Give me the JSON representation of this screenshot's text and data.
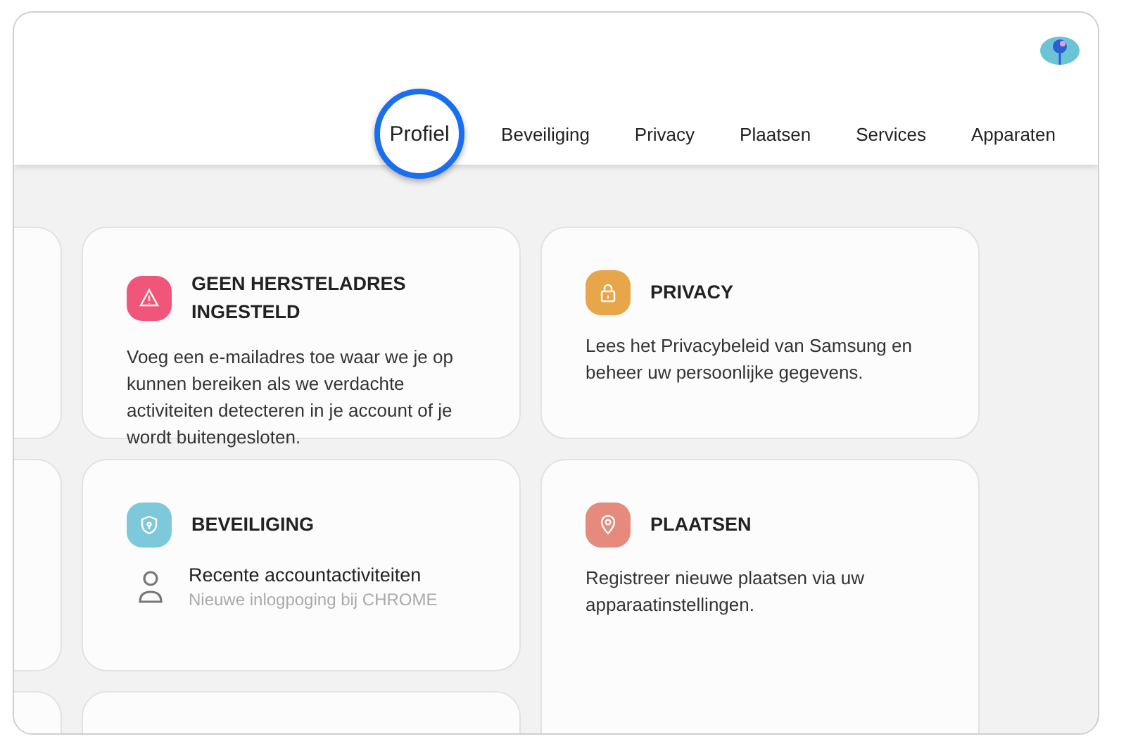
{
  "header": {
    "tabs": [
      {
        "label": "Profiel",
        "selected": true
      },
      {
        "label": "Beveiliging",
        "selected": false
      },
      {
        "label": "Privacy",
        "selected": false
      },
      {
        "label": "Plaatsen",
        "selected": false
      },
      {
        "label": "Services",
        "selected": false
      },
      {
        "label": "Apparaten",
        "selected": false
      }
    ]
  },
  "cards": [
    {
      "kind": "text",
      "color": "#f0557a",
      "title": "GEEN HERSTELADRES INGESTELD",
      "body": "Voeg een e-mailadres toe waar we je op kunnen bereiken als we verdachte activiteiten detecteren in je account of je wordt buitengesloten."
    },
    {
      "kind": "text",
      "color": "#e8a64a",
      "title": "PRIVACY",
      "body": "Lees het Privacybeleid van Samsung en beheer uw persoonlijke gegevens."
    },
    {
      "kind": "activity",
      "color": "#7ec8dc",
      "title": "BEVEILIGING",
      "activity": {
        "title": "Recente accountactiviteiten",
        "subtitle": "Nieuwe inlogpoging bij CHROME"
      }
    },
    {
      "kind": "text",
      "color": "#e58a7c",
      "title": "PLAATSEN",
      "body": "Registreer nieuwe plaatsen via uw apparaatinstellingen."
    }
  ]
}
